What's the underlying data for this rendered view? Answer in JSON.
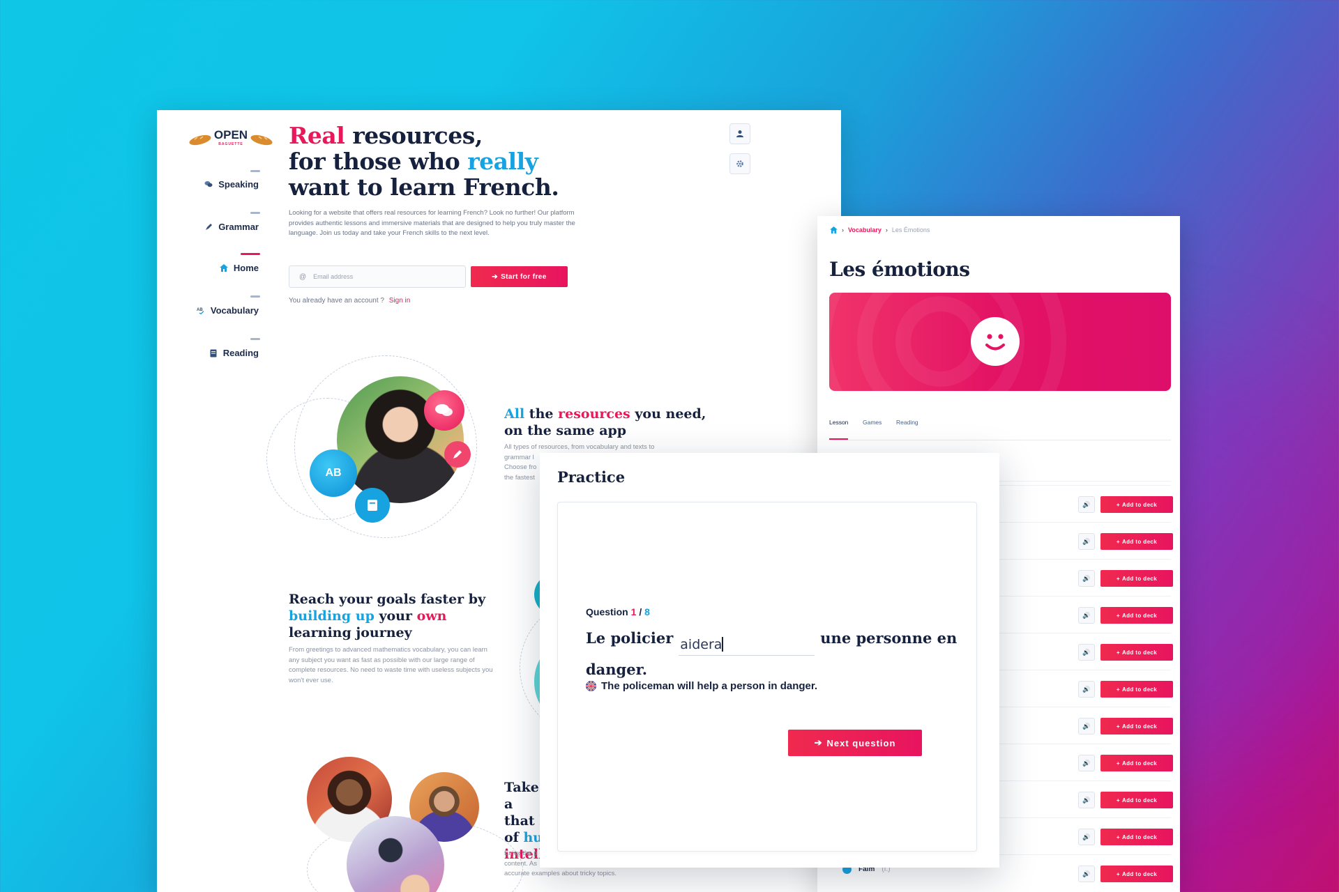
{
  "landing": {
    "brand": {
      "logo_word": "OPEN",
      "logo_sub": "BAGUETTE"
    },
    "nav": [
      {
        "label": "Speaking",
        "icon": "speech-bubbles-icon"
      },
      {
        "label": "Grammar",
        "icon": "pen-icon"
      },
      {
        "label": "Home",
        "icon": "home-icon",
        "active": true
      },
      {
        "label": "Vocabulary",
        "icon": "vocabulary-icon"
      },
      {
        "label": "Reading",
        "icon": "book-icon"
      }
    ],
    "hero": {
      "title_w1": "Real",
      "title_w2": " resources,",
      "title_w3": "for those who ",
      "title_w4": "really",
      "title_w5": "want to learn French.",
      "description": "Looking for a website that offers real resources for learning French? Look no further! Our platform provides authentic lessons and immersive materials that are designed to help you truly master the language. Join us today and take your French skills to the next level.",
      "email_placeholder": "Email address",
      "start_label": "Start for free",
      "already": "You already have an account ?",
      "signin": "Sign in"
    },
    "feature1": {
      "title_a": "All",
      "title_b": " the ",
      "title_c": "resources",
      "title_d": " you need, on the same app",
      "desc_1": "All types of resources, from vocabulary and texts to",
      "desc_2": "grammar l",
      "desc_3": "Choose fro",
      "desc_4": "the fastest",
      "bubble_ab": "AB"
    },
    "feature2": {
      "title_a": "Reach your goals faster by ",
      "title_b": "building up",
      "title_c": " your ",
      "title_d": "own",
      "title_e": " learning journey",
      "desc": "From greetings to advanced mathematics vocabulary, you can learn any subject you want as fast as possible with our large range of complete resources. No need to waste time with useless subjects you won't ever use."
    },
    "feature3": {
      "line1": "Take a",
      "line2": "that l",
      "line3a": "of ",
      "line3b": "hu",
      "line4": "intell",
      "desc_1": "Enjoy the p",
      "desc_2": "content. As",
      "desc_3": "accurate examples about tricky topics."
    }
  },
  "vocab_page": {
    "breadcrumb": {
      "home_icon": "home-icon",
      "section": "Vocabulary",
      "current": "Les Émotions"
    },
    "title": "Les émotions",
    "banner_icon": "smiley-icon",
    "tabs": [
      "Lesson",
      "Games",
      "Reading"
    ],
    "active_tab": "Lesson",
    "add_label": "Add to deck",
    "row_count": 11,
    "last_row": {
      "word": "Faim",
      "gender": "(f.)"
    }
  },
  "practice": {
    "title": "Practice",
    "question_label": "Question",
    "question_num": "1",
    "question_sep": " / ",
    "question_total": "8",
    "sentence_start": "Le policier",
    "answer_value": "aidera",
    "sentence_end": "une personne en danger.",
    "translation": "The policeman will help a person in danger.",
    "next_label": "Next question"
  },
  "colors": {
    "accent": "#e8195a",
    "blue": "#17a3e0",
    "navy": "#16213e"
  }
}
